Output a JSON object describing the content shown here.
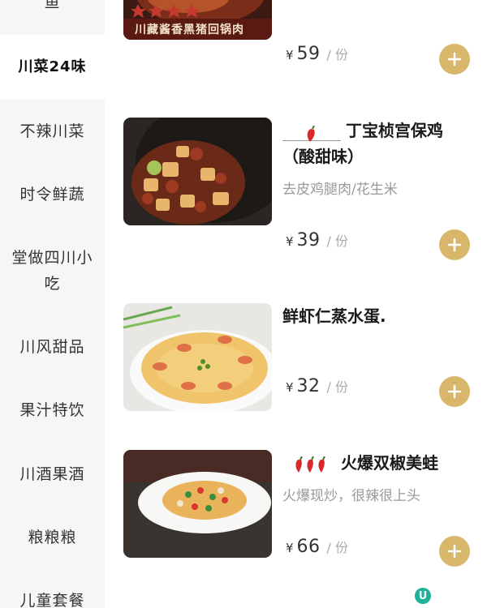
{
  "sidebar": {
    "items": [
      {
        "label": "鱼"
      },
      {
        "label": "川菜24味"
      },
      {
        "label": "不辣川菜"
      },
      {
        "label": "时令鲜蔬"
      },
      {
        "label": "堂做四川小吃"
      },
      {
        "label": "川风甜品"
      },
      {
        "label": "果汁特饮"
      },
      {
        "label": "川酒果酒"
      },
      {
        "label": "粮粮粮"
      },
      {
        "label": "儿童套餐"
      }
    ],
    "active_index": 1
  },
  "dishes": [
    {
      "image_caption": "川藏酱香黑猪回锅肉",
      "price_currency": "¥",
      "price": "59",
      "unit": "/ 份",
      "add_icon": "plus-icon"
    },
    {
      "spicy_level": 1,
      "name": "丁宝桢宫保鸡（酸甜味）",
      "description": "去皮鸡腿肉/花生米",
      "price_currency": "¥",
      "price": "39",
      "unit": "/ 份",
      "add_icon": "plus-icon"
    },
    {
      "spicy_level": 0,
      "name": "鲜虾仁蒸水蛋.",
      "description": "",
      "price_currency": "¥",
      "price": "32",
      "unit": "/ 份",
      "add_icon": "plus-icon"
    },
    {
      "spicy_level": 3,
      "name": "火爆双椒美蛙",
      "description": "火爆现炒，很辣很上头",
      "price_currency": "¥",
      "price": "66",
      "unit": "/ 份",
      "add_icon": "plus-icon"
    }
  ],
  "badge": {
    "label": "U"
  },
  "colors": {
    "accent": "#d9b76a",
    "sidebar_bg": "#f6f6f6",
    "chili": "#d8282a",
    "badge": "#1db19a"
  }
}
